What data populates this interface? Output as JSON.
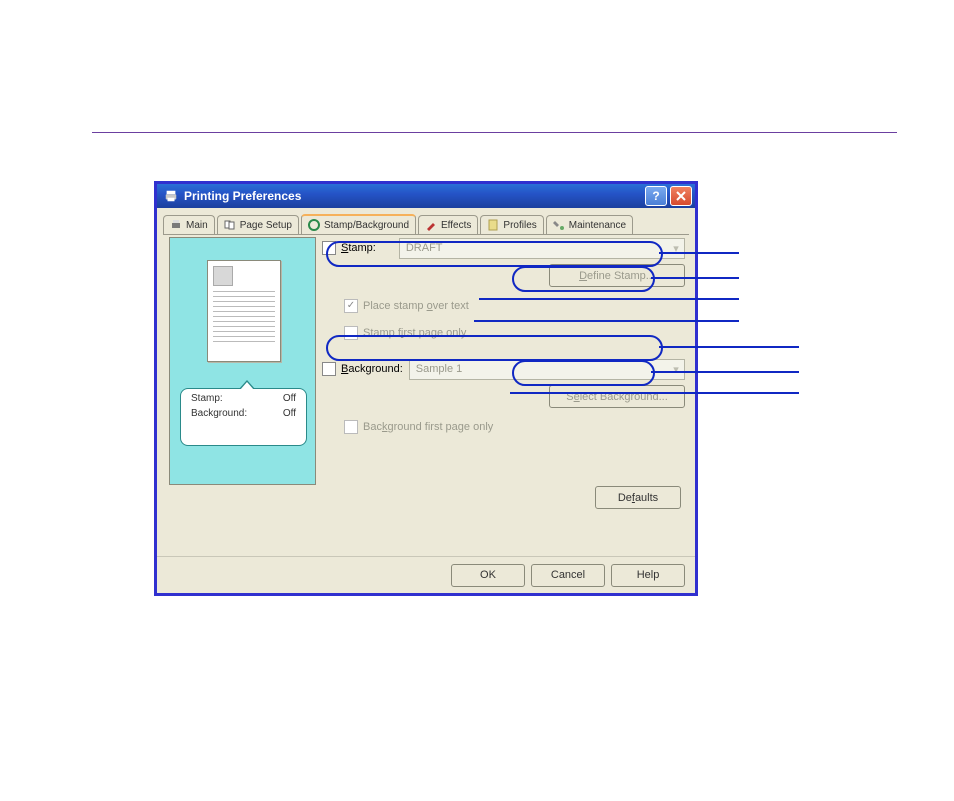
{
  "titlebar": {
    "title": "Printing Preferences"
  },
  "tabs": {
    "main": "Main",
    "page_setup": "Page Setup",
    "stamp_bg": "Stamp/Background",
    "effects": "Effects",
    "profiles": "Profiles",
    "maintenance": "Maintenance"
  },
  "preview": {
    "rows": [
      {
        "label": "Stamp:",
        "value": "Off"
      },
      {
        "label": "Background:",
        "value": "Off"
      }
    ]
  },
  "stamp": {
    "label": "Stamp:",
    "selected": "DRAFT",
    "define_btn": "Define Stamp...",
    "place_over": "Place stamp over text",
    "first_page": "Stamp first page only"
  },
  "background": {
    "label": "Background:",
    "selected": "Sample 1",
    "select_btn": "Select Background...",
    "first_page": "Background first page only"
  },
  "buttons": {
    "defaults": "Defaults",
    "ok": "OK",
    "cancel": "Cancel",
    "help": "Help"
  }
}
